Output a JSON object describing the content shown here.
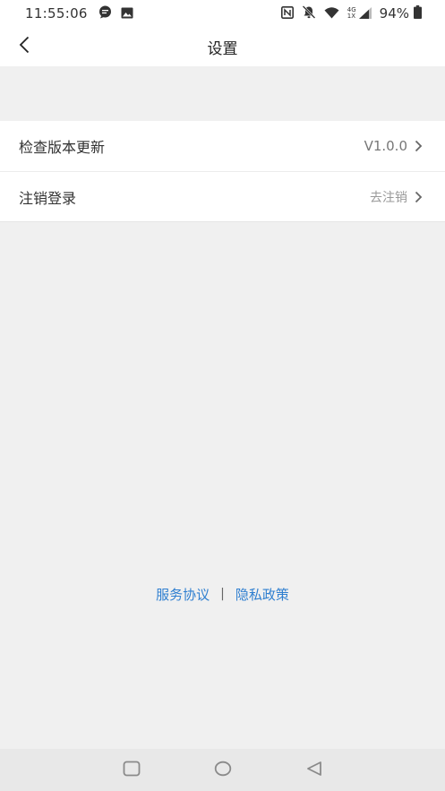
{
  "status_bar": {
    "time": "11:55:06",
    "network_top": "4G",
    "network_bottom": "1X",
    "battery": "94%"
  },
  "header": {
    "title": "设置"
  },
  "settings": [
    {
      "label": "检查版本更新",
      "value": "V1.0.0"
    },
    {
      "label": "注销登录",
      "value": "去注销"
    }
  ],
  "footer": {
    "service_agreement": "服务协议",
    "separator": "|",
    "privacy_policy": "隐私政策"
  },
  "colors": {
    "link": "#2f7fd0",
    "background": "#f0f0f0"
  }
}
